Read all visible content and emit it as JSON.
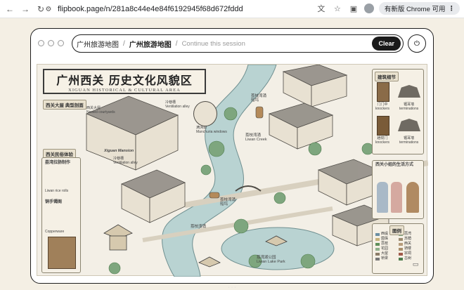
{
  "browser": {
    "url": "flipbook.page/n/281a8c44e4e84f6192945f68d672fddd",
    "update_label": "有新版 Chrome 可用"
  },
  "app": {
    "breadcrumbs": [
      "广州旅游地图",
      "广州旅游地图"
    ],
    "session_placeholder": "Continue this session",
    "clear_label": "Clear"
  },
  "map": {
    "title_zh": "广州西关 历史文化风貌区",
    "title_en": "XIGUAN HISTORICAL & CULTURAL AREA",
    "sections": {
      "mansion": "西关大屋 典型剖面",
      "folk": "西关民俗体验",
      "details": "建筑细节",
      "lady": "西关小姐的生活方式",
      "legend": "图例"
    },
    "labels": {
      "nested": "西关大屋\nNested courtyards",
      "mansion_en": "Xiguan Mansion",
      "vent1": "冷巷槽\nVentilation alley",
      "vent2": "冷巷槽\nVentilation alley",
      "windows": "满洲窗\nManchuria windows",
      "ricerolls": "荔湾拉肠制作",
      "ricerolls_en": "Liwan rice rolls",
      "copper": "铜手镯阁",
      "copper_en": "Copperware",
      "creek1": "荔枝湾涌\n船坞",
      "creek2": "荔枝湾涌\nLiwan Creek",
      "creek3": "荔枝湾涌\n船坞",
      "creek4": "荔枝湾涌",
      "lake": "荔湾湖公园\nLiwan Lake Park",
      "door1": "门门中\nknockers",
      "door2": "趟栊门\nknockers",
      "ridge1": "镬耳墙\nterminations",
      "ridge2": "镬耳墙\nterminations"
    },
    "legend": [
      {
        "label": "西堤",
        "color": "#6b8fa3"
      },
      {
        "label": "荔湾",
        "color": "#7ea67e"
      },
      {
        "label": "茵珠",
        "color": "#c7b27a"
      },
      {
        "label": "苏荫",
        "color": "#9b8a6f"
      },
      {
        "label": "荔枝",
        "color": "#5f8f5a"
      },
      {
        "label": "西关",
        "color": "#b59c7b"
      },
      {
        "label": "花园",
        "color": "#8fb08a"
      },
      {
        "label": "骑楼",
        "color": "#a88f6c"
      },
      {
        "label": "大屋",
        "color": "#8c7d68"
      },
      {
        "label": "宗祠",
        "color": "#a05a4a"
      },
      {
        "label": "桥梁",
        "color": "#777777"
      },
      {
        "label": "古树",
        "color": "#4e7c4e"
      }
    ]
  }
}
